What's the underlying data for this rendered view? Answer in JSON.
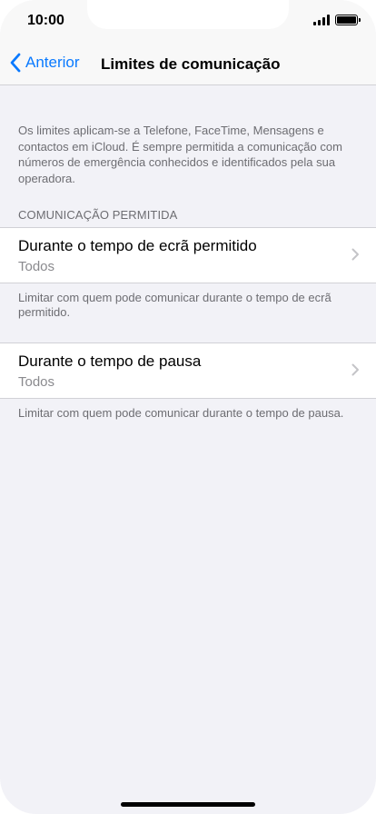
{
  "status_bar": {
    "time": "10:00",
    "icons": [
      "cellular-signal-icon",
      "battery-icon"
    ]
  },
  "nav": {
    "back_label": "Anterior",
    "title": "Limites de comunicação"
  },
  "intro_text": "Os limites aplicam-se a Telefone, FaceTime, Mensagens e contactos em iCloud. É sempre permitida a comunicação com números de emergência conhecidos e identificados pela sua operadora.",
  "section_header": "COMUNICAÇÃO PERMITIDA",
  "cells": [
    {
      "title": "Durante o tempo de ecrã permitido",
      "value": "Todos",
      "footer": "Limitar com quem pode comunicar durante o tempo de ecrã permitido."
    },
    {
      "title": "Durante o tempo de pausa",
      "value": "Todos",
      "footer": "Limitar com quem pode comunicar durante o tempo de pausa."
    }
  ],
  "colors": {
    "accent": "#0a7aff",
    "background": "#f2f2f7",
    "secondary_text": "#6d6d72"
  }
}
